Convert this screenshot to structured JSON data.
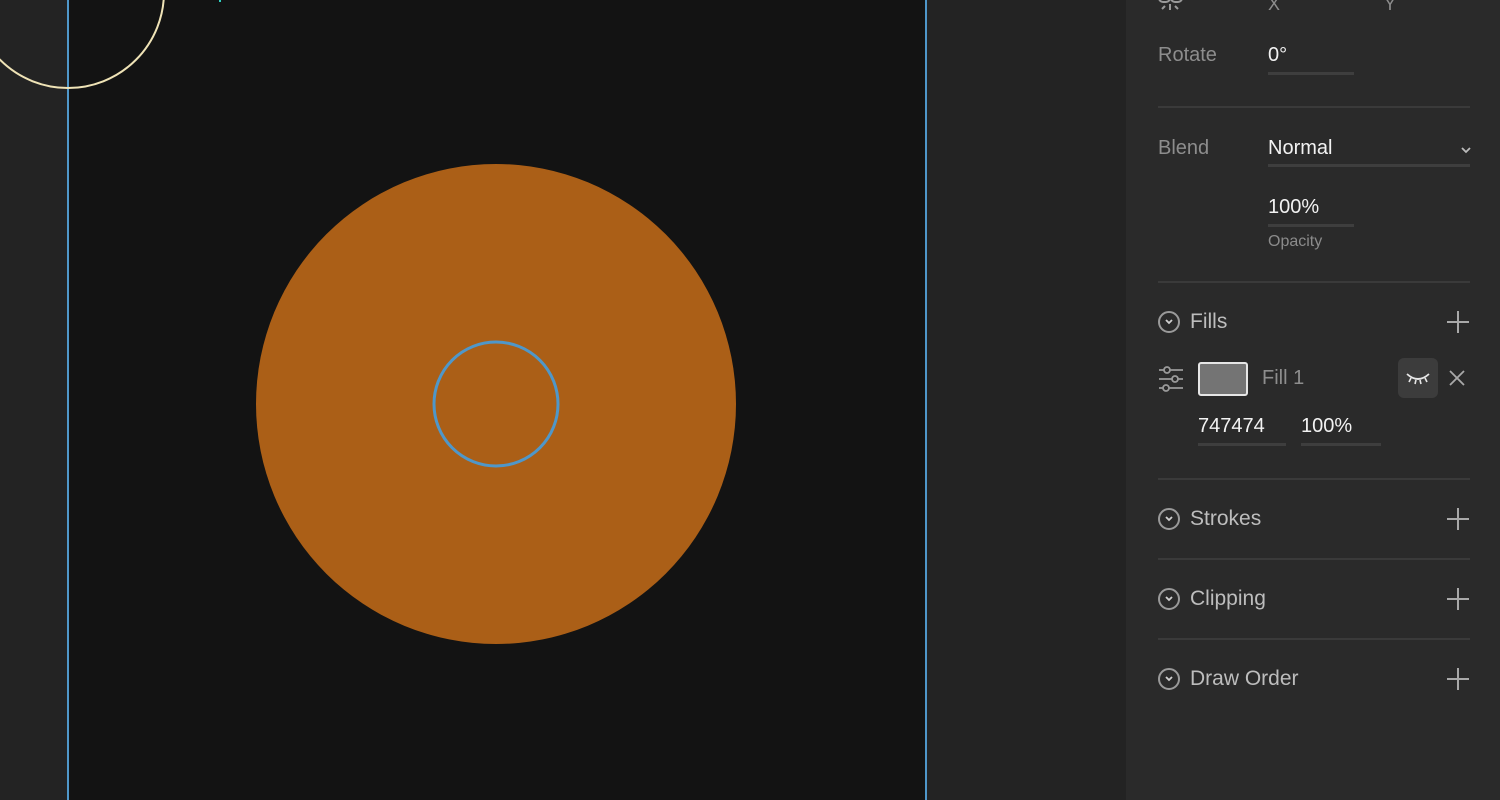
{
  "panel": {
    "transform": {
      "x_label": "X",
      "y_label": "Y",
      "rotate_label": "Rotate",
      "rotate_value": "0°"
    },
    "blend": {
      "label": "Blend",
      "mode": "Normal",
      "opacity_value": "100%",
      "opacity_label": "Opacity"
    },
    "fills": {
      "title": "Fills",
      "items": [
        {
          "name": "Fill 1",
          "hex": "747474",
          "opacity": "100%",
          "swatch_color": "#747474"
        }
      ]
    },
    "sections": [
      {
        "title": "Strokes"
      },
      {
        "title": "Clipping"
      },
      {
        "title": "Draw Order"
      }
    ]
  },
  "canvas": {
    "shape_fill_color": "#ab5f17",
    "selection_color": "#4f97c9",
    "artboard_color": "#131313"
  },
  "icons": [
    "link-icon",
    "chevron-down-icon",
    "sliders-icon",
    "eye-closed-icon",
    "close-icon",
    "plus-icon"
  ]
}
